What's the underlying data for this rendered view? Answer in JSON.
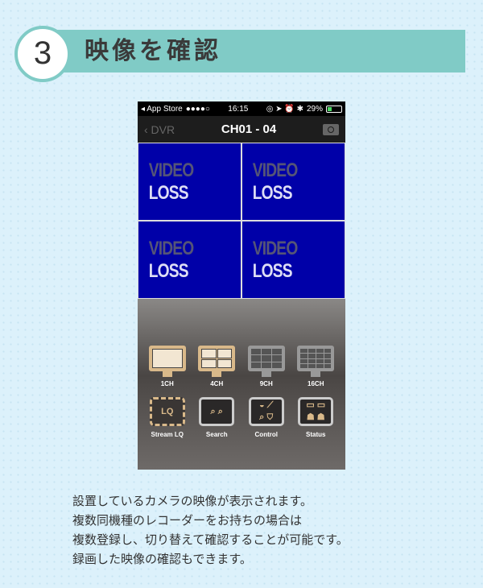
{
  "step": {
    "number": "3",
    "title": "映像を確認"
  },
  "phone": {
    "status": {
      "carrier": "◂ App Store",
      "signal": "●●●●○",
      "time": "16:15",
      "icons": "◎ ➤ ⏰ ✱",
      "battery": "29%",
      "battery_level": 0.29
    },
    "nav": {
      "back": "‹ DVR",
      "title": "CH01 - 04",
      "camera_icon": "camera-icon"
    },
    "tiles": [
      {
        "a": "VIDEO",
        "b": "LOSS"
      },
      {
        "a": "VIDEO",
        "b": "LOSS"
      },
      {
        "a": "VIDEO",
        "b": "LOSS"
      },
      {
        "a": "VIDEO",
        "b": "LOSS"
      }
    ],
    "buttons": [
      "1CH",
      "4CH",
      "9CH",
      "16CH",
      "Stream LQ",
      "Search",
      "Control",
      "Status"
    ],
    "colors": {
      "tile": "#0000a8",
      "gold": "#d9b98a"
    }
  },
  "description": [
    "設置しているカメラの映像が表示されます。",
    "複数同機種のレコーダーをお持ちの場合は",
    "複数登録し、切り替えて確認することが可能です。",
    "録画した映像の確認もできます。"
  ]
}
